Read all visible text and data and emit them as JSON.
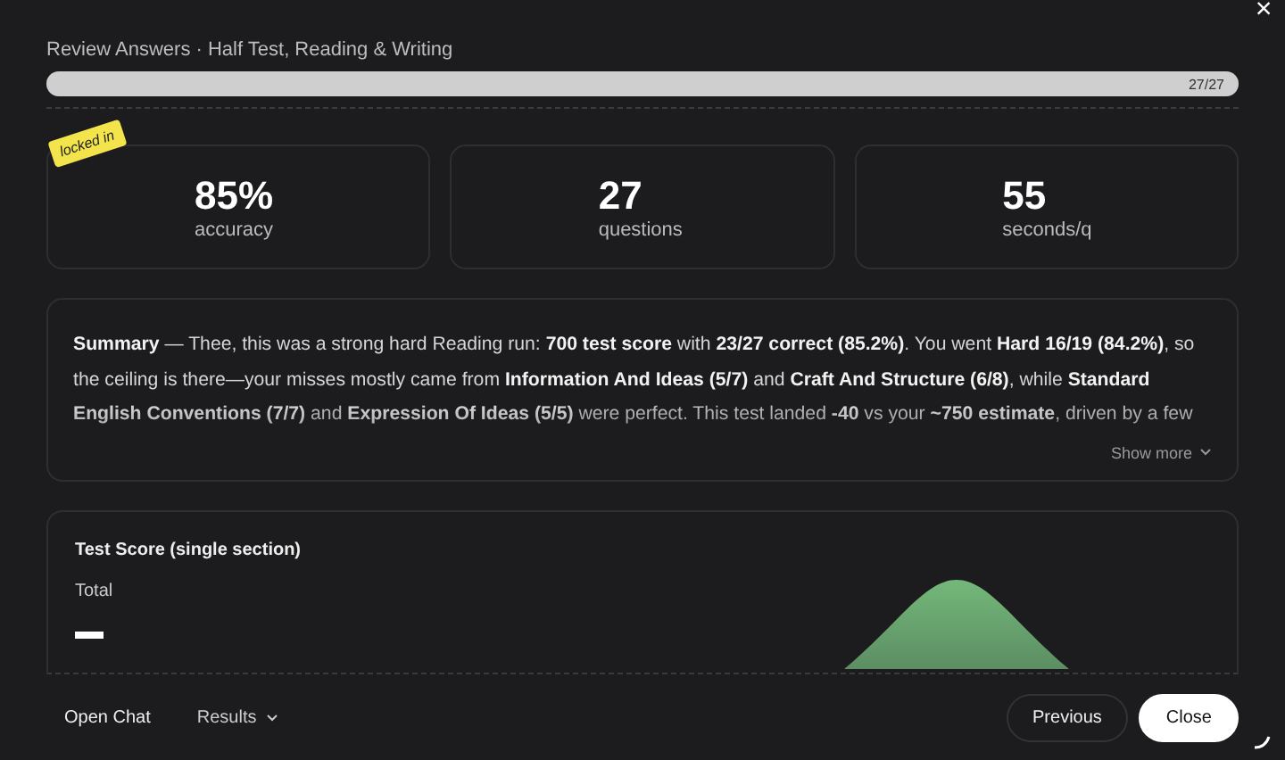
{
  "window": {
    "title": "Review Answers · Half Test, Reading & Writing",
    "close_label": "×"
  },
  "progress": {
    "level": 1,
    "reading": "27/27"
  },
  "sticker": {
    "label": "locked in"
  },
  "stats": [
    {
      "value": "85%",
      "label": "accuracy"
    },
    {
      "value": "27",
      "label": "questions"
    },
    {
      "value": "55",
      "label": "seconds/q"
    }
  ],
  "summary": {
    "text": "**Summary** — Thee, this was a strong hard Reading run: **700 test score** with **23/27 correct (85.2%)**. You went **Hard 16/19 (84.2%)**, so the ceiling is there—your misses mostly came from **Information And Ideas (5/7)** and **Craft And Structure (6/8)**, while **Standard English Conventions (7/7)** and **Expression Of Ideas (5/5)** were perfect. This test landed **-40** vs your **~750 estimate**, driven by a few",
    "show_more": "Show more"
  },
  "score_card": {
    "title": "Test Score (single section)",
    "subtitle": "Total"
  },
  "footer": {
    "left": [
      {
        "label": "Open Chat",
        "kind": "link"
      },
      {
        "label": "Results",
        "kind": "menu"
      }
    ],
    "buttons": [
      {
        "label": "Previous",
        "primary": false
      },
      {
        "label": "Close",
        "primary": true
      }
    ]
  }
}
